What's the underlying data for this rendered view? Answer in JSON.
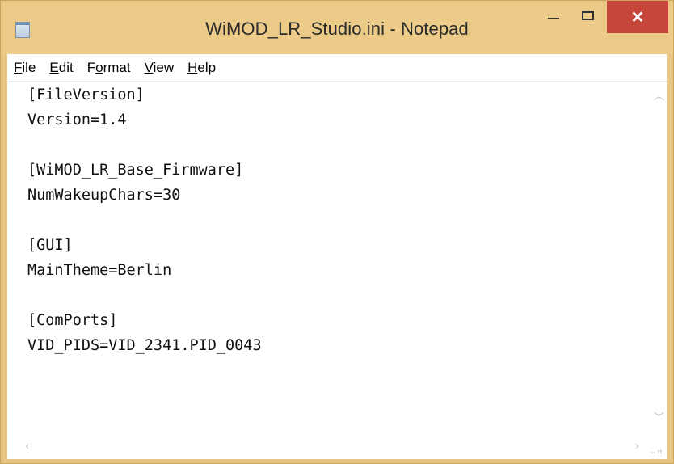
{
  "window": {
    "title": "WiMOD_LR_Studio.ini - Notepad",
    "close_glyph": "✕"
  },
  "menu": [
    {
      "label": "File",
      "underline": "F"
    },
    {
      "label": "Edit",
      "underline": "E"
    },
    {
      "label": "Format",
      "underline": "o"
    },
    {
      "label": "View",
      "underline": "V"
    },
    {
      "label": "Help",
      "underline": "H"
    }
  ],
  "document": {
    "lines": [
      "[FileVersion]",
      "Version=1.4",
      "",
      "[WiMOD_LR_Base_Firmware]",
      "NumWakeupChars=30",
      "",
      "[GUI]",
      "MainTheme=Berlin",
      "",
      "[ComPorts]",
      "VID_PIDS=VID_2341.PID_0043"
    ]
  },
  "icons": {
    "app": "notepad-icon",
    "minimize": "minimize-icon",
    "maximize": "maximize-icon",
    "close": "close-icon",
    "scroll_up": "chevron-up-icon",
    "scroll_down": "chevron-down-icon",
    "scroll_left": "chevron-left-icon",
    "scroll_right": "chevron-right-icon",
    "resize": "resize-grip-icon"
  },
  "colors": {
    "title_bar": "#eccb89",
    "close_button": "#c7463c"
  }
}
